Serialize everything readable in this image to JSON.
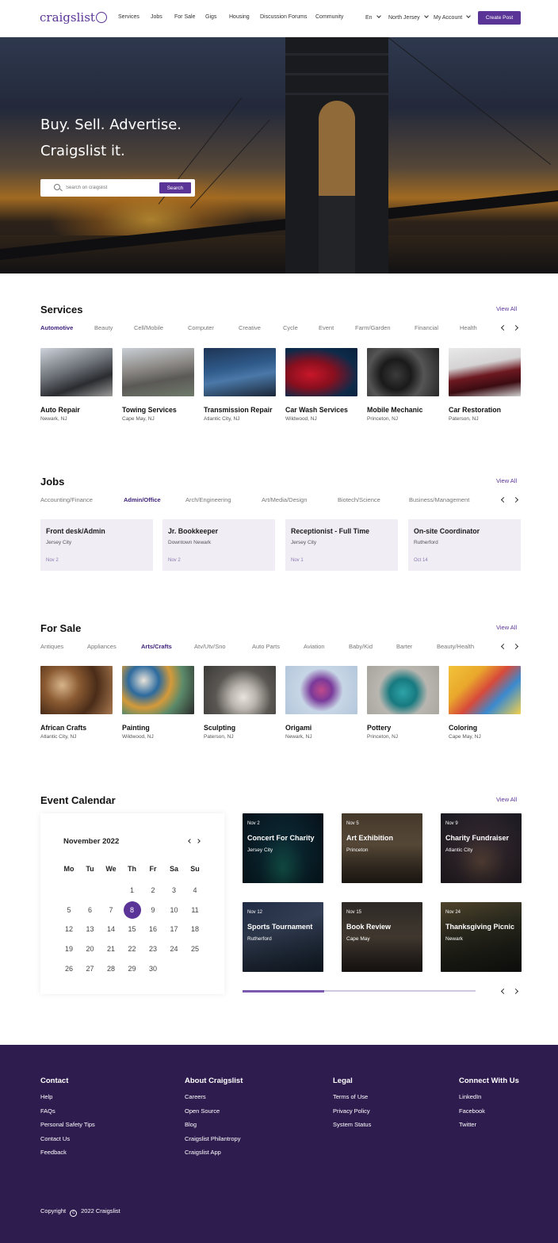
{
  "header": {
    "logo": "craigslist",
    "nav": [
      "Services",
      "Jobs",
      "For Sale",
      "Gigs",
      "Housing",
      "Discussion Forums",
      "Community"
    ],
    "language": "En",
    "location": "North Jersey",
    "account": "My Account",
    "create_post": "Create Post"
  },
  "hero": {
    "line1": "Buy. Sell. Advertise.",
    "line2": "Craigslist it.",
    "search_placeholder": "Search on craigslist",
    "search_button": "Search"
  },
  "services": {
    "title": "Services",
    "view_all": "View All",
    "categories": [
      "Automotive",
      "Beauty",
      "Cell/Mobile",
      "Computer",
      "Creative",
      "Cycle",
      "Event",
      "Farm/Garden",
      "Financial",
      "Health"
    ],
    "active": "Automotive",
    "cards": [
      {
        "title": "Auto Repair",
        "location": "Newark, NJ"
      },
      {
        "title": "Towing Services",
        "location": "Cape May, NJ"
      },
      {
        "title": "Transmission Repair",
        "location": "Atlantic City, NJ"
      },
      {
        "title": "Car Wash Services",
        "location": "Wildwood, NJ"
      },
      {
        "title": "Mobile Mechanic",
        "location": "Princeton, NJ"
      },
      {
        "title": "Car Restoration",
        "location": "Paterson, NJ"
      }
    ]
  },
  "jobs": {
    "title": "Jobs",
    "view_all": "View All",
    "categories": [
      "Accounting/Finance",
      "Admin/Office",
      "Arch/Engineering",
      "Art/Media/Design",
      "Biotech/Science",
      "Business/Management"
    ],
    "active": "Admin/Office",
    "cards": [
      {
        "title": "Front desk/Admin",
        "location": "Jersey City",
        "date": "Nov 2"
      },
      {
        "title": "Jr. Bookkeeper",
        "location": "Downtown Newark",
        "date": "Nov 2"
      },
      {
        "title": "Receptionist - Full Time",
        "location": "Jersey City",
        "date": "Nov 1"
      },
      {
        "title": "On-site Coordinator",
        "location": "Rutherford",
        "date": "Oct 14"
      }
    ]
  },
  "for_sale": {
    "title": "For Sale",
    "view_all": "View All",
    "categories": [
      "Antiques",
      "Appliances",
      "Arts/Crafts",
      "Atv/Utv/Sno",
      "Auto Parts",
      "Aviation",
      "Baby/Kid",
      "Barter",
      "Beauty/Health"
    ],
    "active": "Arts/Crafts",
    "cards": [
      {
        "title": "African Crafts",
        "location": "Atlantic City, NJ"
      },
      {
        "title": "Painting",
        "location": "Wildwood, NJ"
      },
      {
        "title": "Sculpting",
        "location": "Paterson, NJ"
      },
      {
        "title": "Origami",
        "location": "Newark, NJ"
      },
      {
        "title": "Pottery",
        "location": "Princeton, NJ"
      },
      {
        "title": "Coloring",
        "location": "Cape May, NJ"
      }
    ]
  },
  "events": {
    "title": "Event Calendar",
    "view_all": "View All",
    "calendar": {
      "month": "November 2022",
      "weekdays": [
        "Mo",
        "Tu",
        "We",
        "Th",
        "Fr",
        "Sa",
        "Su"
      ],
      "first_weekday_index": 3,
      "days": 30,
      "selected": 8
    },
    "cards": [
      {
        "date": "Nov 2",
        "title": "Concert For Charity",
        "location": "Jersey City"
      },
      {
        "date": "Nov 5",
        "title": "Art Exhibition",
        "location": "Princeton"
      },
      {
        "date": "Nov 9",
        "title": "Charity Fundraiser",
        "location": "Atlantic City"
      },
      {
        "date": "Nov 12",
        "title": "Sports Tournament",
        "location": "Rutherford"
      },
      {
        "date": "Nov 15",
        "title": "Book Review",
        "location": "Cape May"
      },
      {
        "date": "Nov 24",
        "title": "Thanksgiving Picnic",
        "location": "Newark"
      }
    ],
    "progress_fraction": 0.35
  },
  "footer": {
    "columns": [
      {
        "title": "Contact",
        "links": [
          "Help",
          "FAQs",
          "Personal Safety Tips",
          "Contact Us",
          "Feedback"
        ]
      },
      {
        "title": "About Craigslist",
        "links": [
          "Careers",
          "Open Source",
          "Blog",
          "Craigslist Philantropy",
          "Craigslist App"
        ]
      },
      {
        "title": "Legal",
        "links": [
          "Terms of Use",
          "Privacy Policy",
          "System Status"
        ]
      },
      {
        "title": "Connect With Us",
        "links": [
          "LinkedIn",
          "Facebook",
          "Twitter"
        ]
      }
    ],
    "copyright_label": "Copyright",
    "copyright_year": "2022 Craigslist"
  },
  "colors": {
    "accent": "#5b3497",
    "footer_bg": "#2f1c4f",
    "job_card_bg": "#f1edf5"
  }
}
